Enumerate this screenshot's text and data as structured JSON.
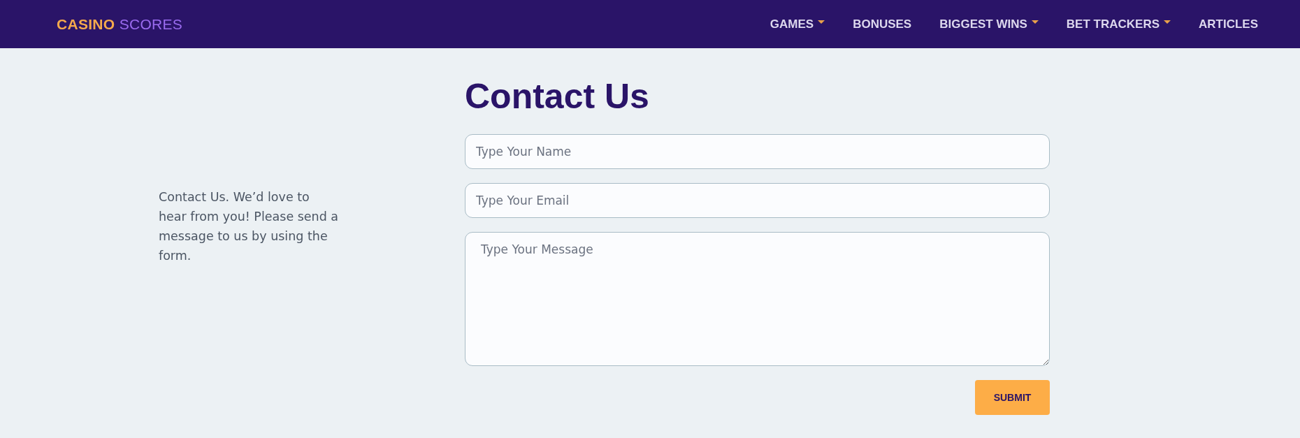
{
  "brand": {
    "first": "CASINO",
    "second": "SCORES"
  },
  "nav": [
    {
      "label": "GAMES",
      "dropdown": true
    },
    {
      "label": "BONUSES",
      "dropdown": false
    },
    {
      "label": "BIGGEST WINS",
      "dropdown": true
    },
    {
      "label": "BET TRACKERS",
      "dropdown": true
    },
    {
      "label": "ARTICLES",
      "dropdown": false
    }
  ],
  "intro": "Contact Us. We’d love to hear from you! Please send a message to us by using the form.",
  "heading": "Contact Us",
  "form": {
    "name": {
      "placeholder": "Type Your Name"
    },
    "email": {
      "placeholder": "Type Your Email"
    },
    "message": {
      "placeholder": "Type Your Message"
    },
    "submit": "SUBMIT"
  }
}
